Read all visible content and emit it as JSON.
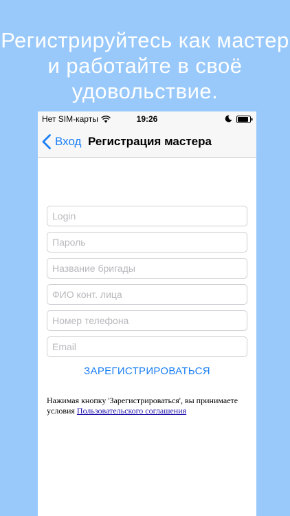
{
  "headline": {
    "line1": "Регистрируйтесь как мастер",
    "line2": "и работайте в своё",
    "line3": "удовольствие."
  },
  "status_bar": {
    "carrier": "Нет SIM-карты",
    "time": "19:26"
  },
  "nav": {
    "back_label": "Вход",
    "title": "Регистрация мастера"
  },
  "form": {
    "login_placeholder": "Login",
    "password_placeholder": "Пароль",
    "team_placeholder": "Название бригады",
    "contact_placeholder": "ФИО конт. лица",
    "phone_placeholder": "Номер телефона",
    "email_placeholder": "Email",
    "register_label": "ЗАРЕГИСТРИРОВАТЬСЯ"
  },
  "terms": {
    "text": "Нажимая кнопку 'Зарегистрироваться', вы принимаете условия",
    "link": "Пользовательского соглашения"
  },
  "colors": {
    "background": "#99c9fb",
    "accent": "#1a7ff5",
    "link": "#1a0dab"
  }
}
